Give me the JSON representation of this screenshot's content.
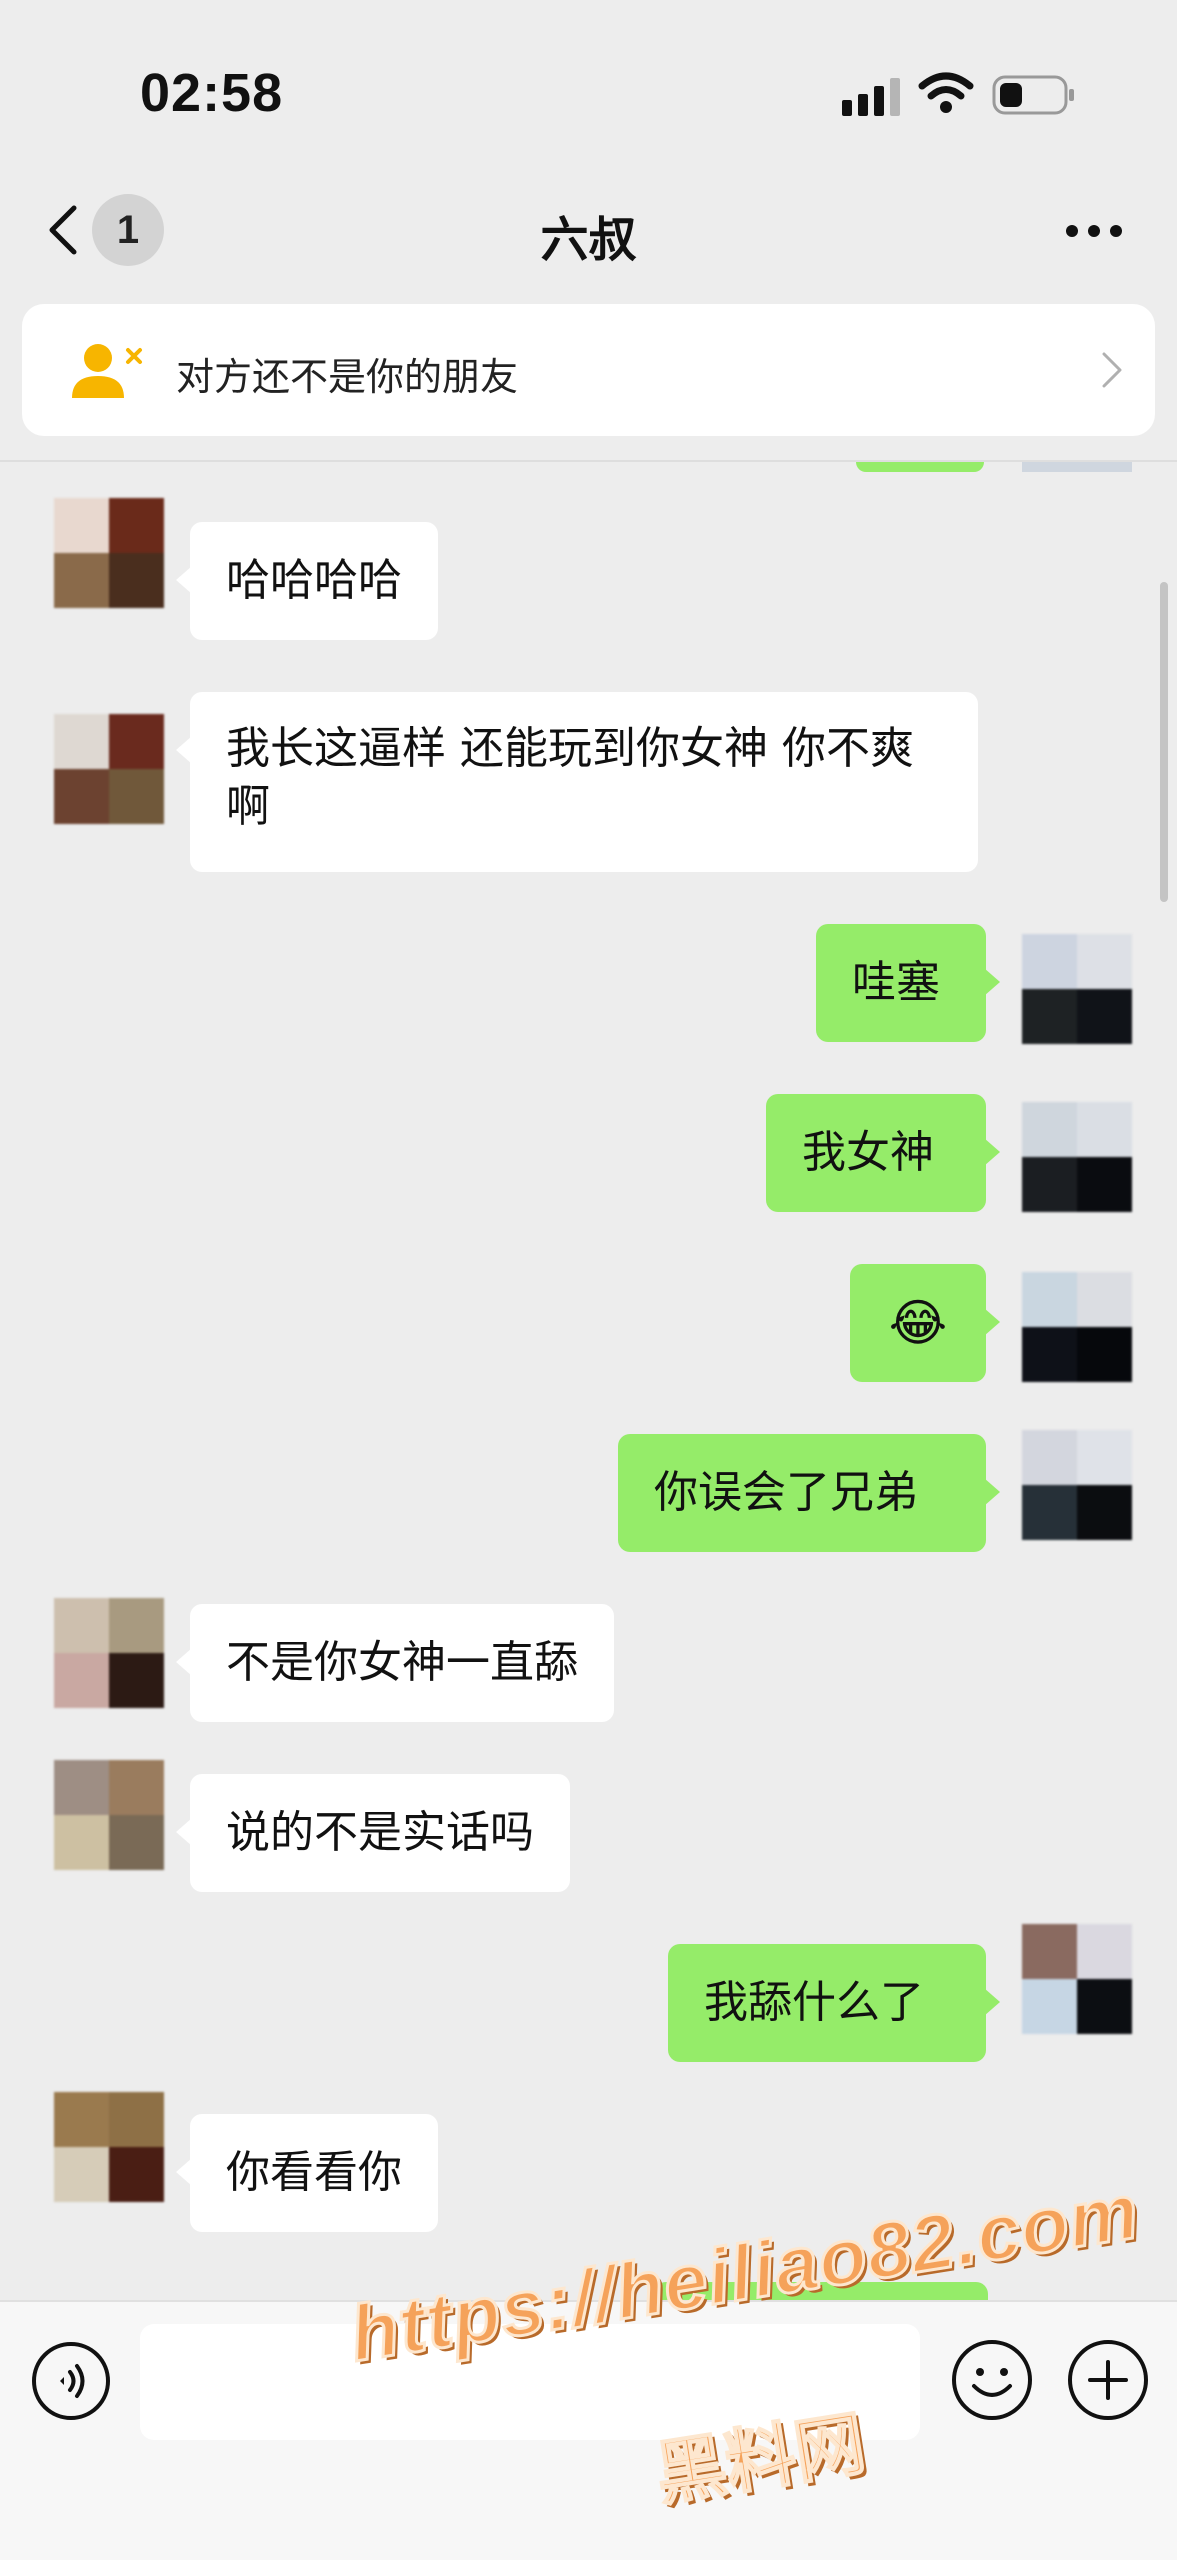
{
  "status_bar": {
    "time": "02:58",
    "icons": [
      "signal-icon",
      "wifi-icon",
      "battery-icon"
    ]
  },
  "nav": {
    "back_icon": "chevron-left-icon",
    "unread_count": "1",
    "title": "六叔",
    "more_icon": "ellipsis-icon"
  },
  "notice": {
    "icon": "add-friend-icon",
    "text": "对方还不是你的朋友"
  },
  "messages": [
    {
      "side": "in",
      "text": "哈哈哈哈"
    },
    {
      "side": "in",
      "text": "我长这逼样 还能玩到你女神 你不爽啊"
    },
    {
      "side": "out",
      "text": "哇塞"
    },
    {
      "side": "out",
      "text": "我女神"
    },
    {
      "side": "out",
      "text": "😂"
    },
    {
      "side": "out",
      "text": "你误会了兄弟"
    },
    {
      "side": "in",
      "text": "不是你女神一直舔"
    },
    {
      "side": "in",
      "text": "说的不是实话吗"
    },
    {
      "side": "out",
      "text": "我舔什么了"
    },
    {
      "side": "in",
      "text": "你看看你"
    }
  ],
  "input_bar": {
    "voice_icon": "voice-icon",
    "input_value": "",
    "emoji_icon": "smiley-icon",
    "plus_icon": "plus-icon"
  },
  "watermark": {
    "url": "https://heiliao82.com",
    "name": "黑料网"
  },
  "colors": {
    "background": "#ededed",
    "outgoing_bubble": "#95ec69",
    "incoming_bubble": "#ffffff",
    "notice_icon": "#f7b500",
    "watermark": "#f5a25a"
  }
}
